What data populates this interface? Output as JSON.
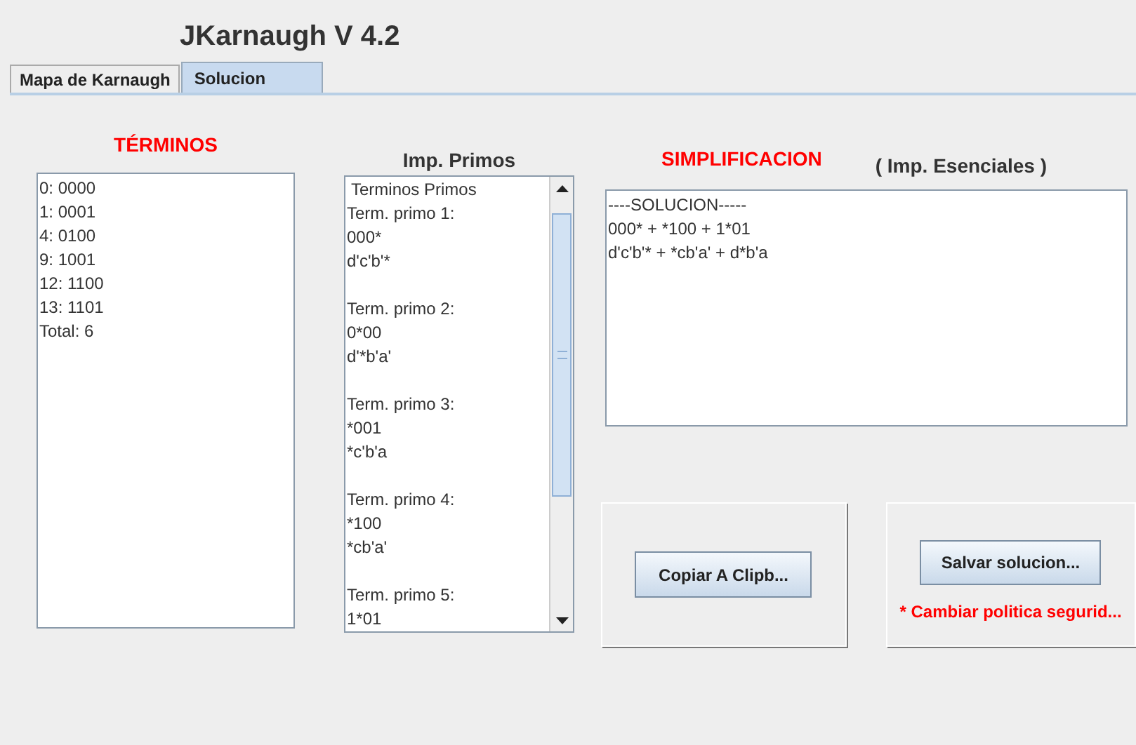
{
  "app_title": "JKarnaugh  V 4.2",
  "tabs": [
    {
      "label": "Mapa de Karnaugh",
      "selected": false
    },
    {
      "label": "Solucion",
      "selected": true
    }
  ],
  "terminos": {
    "heading": "TÉRMINOS",
    "lines": [
      "0: 0000",
      "1: 0001",
      "4: 0100",
      "9: 1001",
      "12: 1100",
      "13: 1101",
      "Total: 6"
    ]
  },
  "primos": {
    "heading": "Imp. Primos",
    "header": "Terminos Primos",
    "terms": [
      {
        "label": "Term. primo 1:",
        "code": "000*",
        "expr": "d'c'b'*"
      },
      {
        "label": "Term. primo 2:",
        "code": "0*00",
        "expr": "d'*b'a'"
      },
      {
        "label": "Term. primo 3:",
        "code": "*001",
        "expr": "*c'b'a"
      },
      {
        "label": "Term. primo 4:",
        "code": "*100",
        "expr": "*cb'a'"
      },
      {
        "label": "Term. primo 5:",
        "code": "1*01"
      }
    ]
  },
  "simplificacion": {
    "heading": "SIMPLIFICACION",
    "subheading": "( Imp. Esenciales )",
    "lines": [
      "----SOLUCION-----",
      "000* + *100 + 1*01",
      "d'c'b'* + *cb'a' + d*b'a"
    ]
  },
  "copy_button": "Copiar A Clipb...",
  "save_button": "Salvar solucion...",
  "warning": "* Cambiar politica segurid..."
}
